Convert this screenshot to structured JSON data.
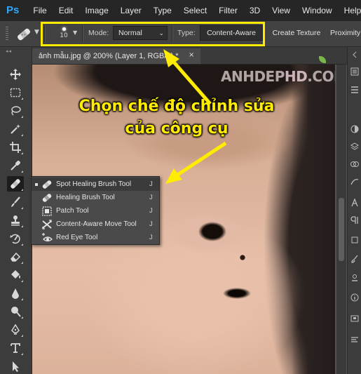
{
  "app": {
    "logo": "Ps"
  },
  "menu": [
    "File",
    "Edit",
    "Image",
    "Layer",
    "Type",
    "Select",
    "Filter",
    "3D",
    "View",
    "Window",
    "Help"
  ],
  "options_bar": {
    "brush_size": "10",
    "mode_label": "Mode:",
    "mode_value": "Normal",
    "type_label": "Type:",
    "type_buttons": [
      "Content-Aware",
      "Create Texture",
      "Proximity"
    ]
  },
  "document": {
    "tab_title": "ảnh mẫu.jpg @ 200% (Layer 1, RGB/8) *",
    "tab_close": "×"
  },
  "watermark": {
    "part1": "ANHDEP",
    "part2": "HD",
    "part3": ".COM"
  },
  "caption": {
    "line1": "Chọn chế độ chỉnh sửa",
    "line2": "của công cụ"
  },
  "flyout": {
    "items": [
      {
        "label": "Spot Healing Brush Tool",
        "shortcut": "J",
        "selected": true,
        "icon": "spot-healing-icon"
      },
      {
        "label": "Healing Brush Tool",
        "shortcut": "J",
        "selected": false,
        "icon": "healing-brush-icon"
      },
      {
        "label": "Patch Tool",
        "shortcut": "J",
        "selected": false,
        "icon": "patch-icon"
      },
      {
        "label": "Content-Aware Move Tool",
        "shortcut": "J",
        "selected": false,
        "icon": "content-aware-move-icon"
      },
      {
        "label": "Red Eye Tool",
        "shortcut": "J",
        "selected": false,
        "icon": "red-eye-icon"
      }
    ]
  },
  "colors": {
    "annotation": "#ffec00",
    "ps_blue": "#31a8ff"
  }
}
